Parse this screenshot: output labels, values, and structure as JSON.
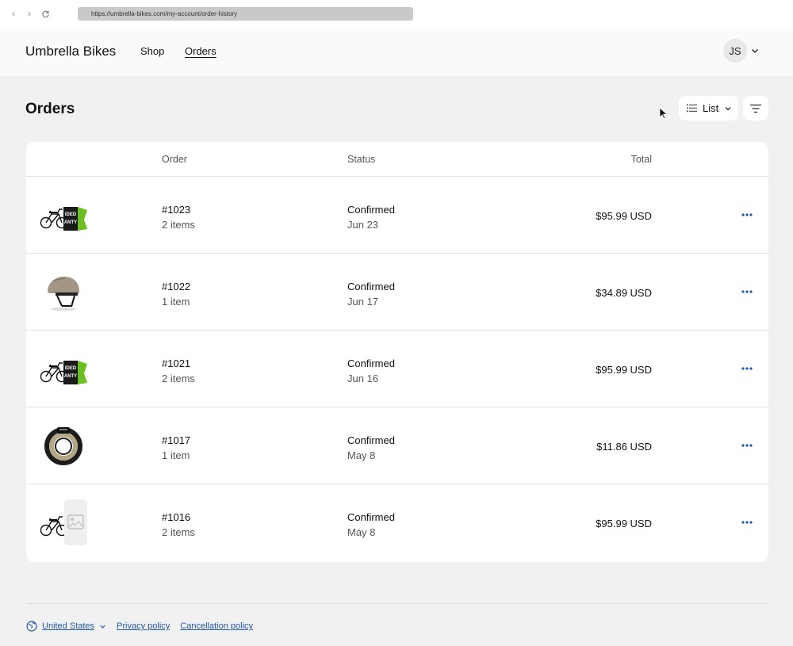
{
  "browser": {
    "url": "https://umbrella-bikes.com/my-account/order-history",
    "back_glyph": "‹",
    "forward_glyph": "›"
  },
  "header": {
    "brand": "Umbrella Bikes",
    "nav": [
      {
        "label": "Shop",
        "active": false
      },
      {
        "label": "Orders",
        "active": true
      }
    ],
    "avatar_initials": "JS"
  },
  "page": {
    "title": "Orders",
    "view_toggle_label": "List"
  },
  "table": {
    "columns": {
      "thumb": "",
      "order": "Order",
      "status": "Status",
      "total": "Total"
    },
    "rows": [
      {
        "order": "#1023",
        "items": "2 items",
        "status": "Confirmed",
        "date": "Jun 23",
        "total": "$95.99 USD",
        "thumb": "bike-warranty"
      },
      {
        "order": "#1022",
        "items": "1 item",
        "status": "Confirmed",
        "date": "Jun 17",
        "total": "$34.89 USD",
        "thumb": "helmet"
      },
      {
        "order": "#1021",
        "items": "2 items",
        "status": "Confirmed",
        "date": "Jun 16",
        "total": "$95.99 USD",
        "thumb": "bike-warranty"
      },
      {
        "order": "#1017",
        "items": "1 item",
        "status": "Confirmed",
        "date": "May 8",
        "total": "$11.86 USD",
        "thumb": "cable-lock"
      },
      {
        "order": "#1016",
        "items": "2 items",
        "status": "Confirmed",
        "date": "May 8",
        "total": "$95.99 USD",
        "thumb": "bike-placeholder"
      }
    ]
  },
  "footer": {
    "country": "United States",
    "links": [
      "Privacy policy",
      "Cancellation policy"
    ]
  },
  "colors": {
    "accent": "#1f57a9",
    "page_bg": "#f1f1f1",
    "card_bg": "#ffffff"
  }
}
